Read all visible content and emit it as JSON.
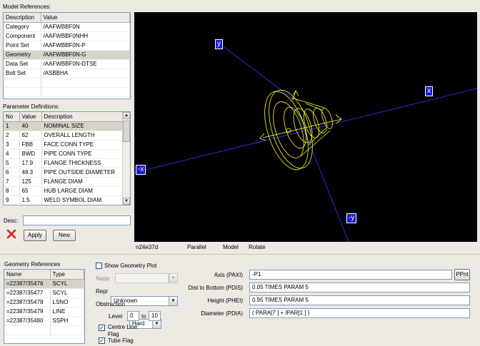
{
  "model_refs": {
    "title": "Model References:",
    "columns": [
      "Description",
      "Value"
    ],
    "rows": [
      [
        "Category",
        "/AAFWBBF0N"
      ],
      [
        "Component",
        "/AAFWBBF0NHH"
      ],
      [
        "Point Set",
        "/AAFWBBF0N-P"
      ],
      [
        "Geometry",
        "/AAFWBBF0N-G"
      ],
      [
        "Data Set",
        "/AAFWBBF0N-DTSE"
      ],
      [
        "Bolt Set",
        "/ASBBHA"
      ]
    ]
  },
  "param_defs": {
    "title": "Parameter Definitions:",
    "columns": [
      "No",
      "Value",
      "Description"
    ],
    "rows": [
      [
        "1",
        "40",
        "NOMINAL SIZE"
      ],
      [
        "2",
        "62",
        "OVERALL LENGTH"
      ],
      [
        "3",
        "FBB",
        "FACE CONN TYPE"
      ],
      [
        "4",
        "BWD",
        "PIPE CONN TYPE"
      ],
      [
        "5",
        "17.9",
        "FLANGE THICKNESS"
      ],
      [
        "6",
        "48.3",
        "PIPE OUTSIDE DIAMETER"
      ],
      [
        "7",
        "125",
        "FLANGE DIAM"
      ],
      [
        "8",
        "65",
        "HUB LARGE DIAM"
      ],
      [
        "9",
        "1.5",
        "WELD SYMBOL DIAM"
      ]
    ]
  },
  "desc_label": "Desc:",
  "desc_value": "",
  "apply_label": "Apply",
  "new_label": "New",
  "viewer": {
    "axis_labels": {
      "y": "y",
      "x": "x",
      "neg_x": "-x",
      "neg_y": "-y"
    },
    "status": [
      "n24e37d",
      "Parallel",
      "Model",
      "Rotate"
    ],
    "colors": {
      "background": "#000000",
      "geometry": "#ffff33",
      "axis": "#2a2ad8"
    }
  },
  "geom_refs": {
    "title": "Geometry References",
    "columns": [
      "Name",
      "Type"
    ],
    "rows": [
      [
        "=22387/35476",
        "SCYL"
      ],
      [
        "=22387/35477",
        "SCYL"
      ],
      [
        "=22387/35478",
        "LSNO"
      ],
      [
        "=22387/35479",
        "LINE"
      ],
      [
        "=22387/35480",
        "SSPH"
      ]
    ]
  },
  "options": {
    "show_geometry_plot": "Show Geometry Plot",
    "napp_label": "Napp",
    "napp_value": "",
    "repr_label": "Repr",
    "repr_value": "Unknown",
    "obstruction_label": "Obstruction",
    "obstruction_value": "Hard",
    "level_label": "Level",
    "level_from": "0",
    "level_to_label": "to",
    "level_to": "10",
    "centre_line_flag": "Centre Line Flag",
    "tube_flag": "Tube Flag"
  },
  "props": {
    "axis_label": "Axis (PAXI)",
    "axis_value": "-P1",
    "ppnt_label": "PPnt",
    "dist_label": "Dist to Bottom (PDIS)",
    "dist_value": "0.05 TIMES PARAM 5",
    "height_label": "Height (PHEI)",
    "height_value": "0.95 TIMES PARAM 5",
    "diameter_label": "Diameter (PDIA)",
    "diameter_value": "( PARA[7 ] + IPAR[1 ] )"
  }
}
